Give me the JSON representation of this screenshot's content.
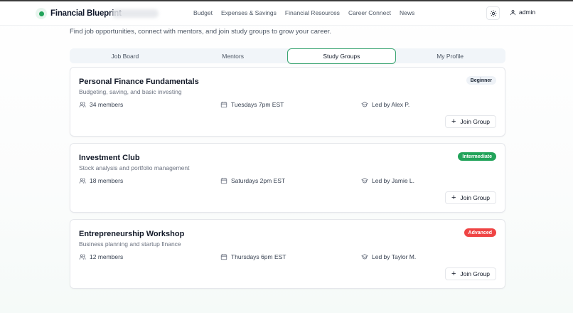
{
  "header": {
    "brand": "Financial Blueprint",
    "nav": [
      "Budget",
      "Expenses & Savings",
      "Financial Resources",
      "Career Connect",
      "News"
    ],
    "user": "admin"
  },
  "page": {
    "subtitle": "Find job opportunities, connect with mentors, and join study groups to grow your career."
  },
  "tabs": [
    {
      "label": "Job Board",
      "active": false
    },
    {
      "label": "Mentors",
      "active": false
    },
    {
      "label": "Study Groups",
      "active": true
    },
    {
      "label": "My Profile",
      "active": false
    }
  ],
  "groups": [
    {
      "title": "Personal Finance Fundamentals",
      "description": "Budgeting, saving, and basic investing",
      "level": "Beginner",
      "members": "34 members",
      "schedule": "Tuesdays 7pm EST",
      "leader": "Led by Alex P.",
      "action": "Join Group"
    },
    {
      "title": "Investment Club",
      "description": "Stock analysis and portfolio management",
      "level": "Intermediate",
      "members": "18 members",
      "schedule": "Saturdays 2pm EST",
      "leader": "Led by Jamie L.",
      "action": "Join Group"
    },
    {
      "title": "Entrepreneurship Workshop",
      "description": "Business planning and startup finance",
      "level": "Advanced",
      "members": "12 members",
      "schedule": "Thursdays 6pm EST",
      "leader": "Led by Taylor M.",
      "action": "Join Group"
    }
  ],
  "colors": {
    "accent": "#22a35a",
    "intermediate": "#22a35a",
    "advanced": "#ef4444",
    "active_tab_border": "#3aa572"
  }
}
